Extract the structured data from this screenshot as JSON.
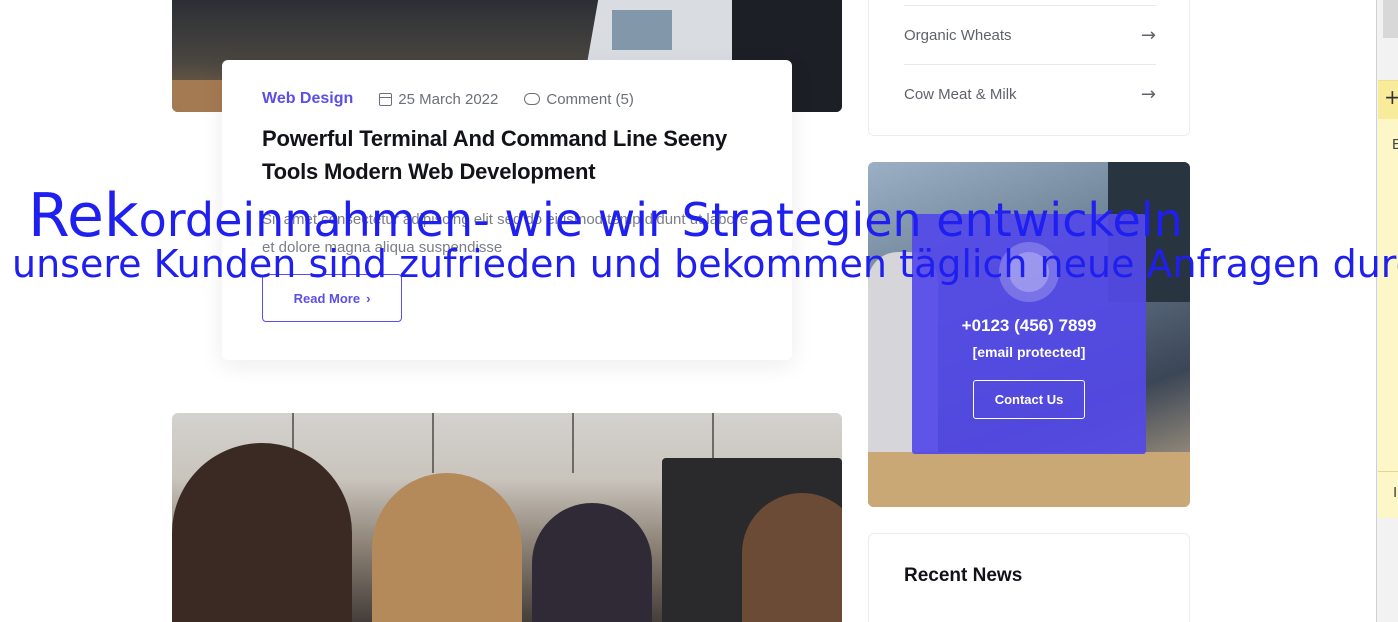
{
  "post": {
    "category": "Web Design",
    "date": "25 March 2022",
    "comments": "Comment (5)",
    "title": "Powerful Terminal And Command Line Seeny Tools Modern Web Development",
    "excerpt": "Sit amet consectetur adipiscing elit sed do eiusmod temp didunt ut labore et dolore magna aliqua suspendisse",
    "read_more": "Read More"
  },
  "sidebar": {
    "categories": [
      {
        "label": "Organic Wheats"
      },
      {
        "label": "Cow Meat & Milk"
      }
    ],
    "contact": {
      "phone": "+0123 (456) 7899",
      "email": "[email protected]",
      "button": "Contact Us"
    },
    "recent_news_title": "Recent News"
  },
  "overlay": {
    "big_prefix": "Rek",
    "line1_rest": "ordeinnahmen- wie wir Strategien entwickeln",
    "line2": "unsere Kunden sind zufrieden und bekommen täglich neue Anfragen durch unsere Weboptimierung"
  },
  "right_panel": {
    "plus": "+",
    "letter_top": "E",
    "letter_bottom": "I"
  },
  "colors": {
    "accent": "#5b4fe6",
    "overlay_text": "#1f1ff0"
  },
  "icons": {
    "date": "calendar-icon",
    "comment": "comment-icon",
    "arrow": "arrow-right-icon",
    "phone": "phone-icon"
  }
}
